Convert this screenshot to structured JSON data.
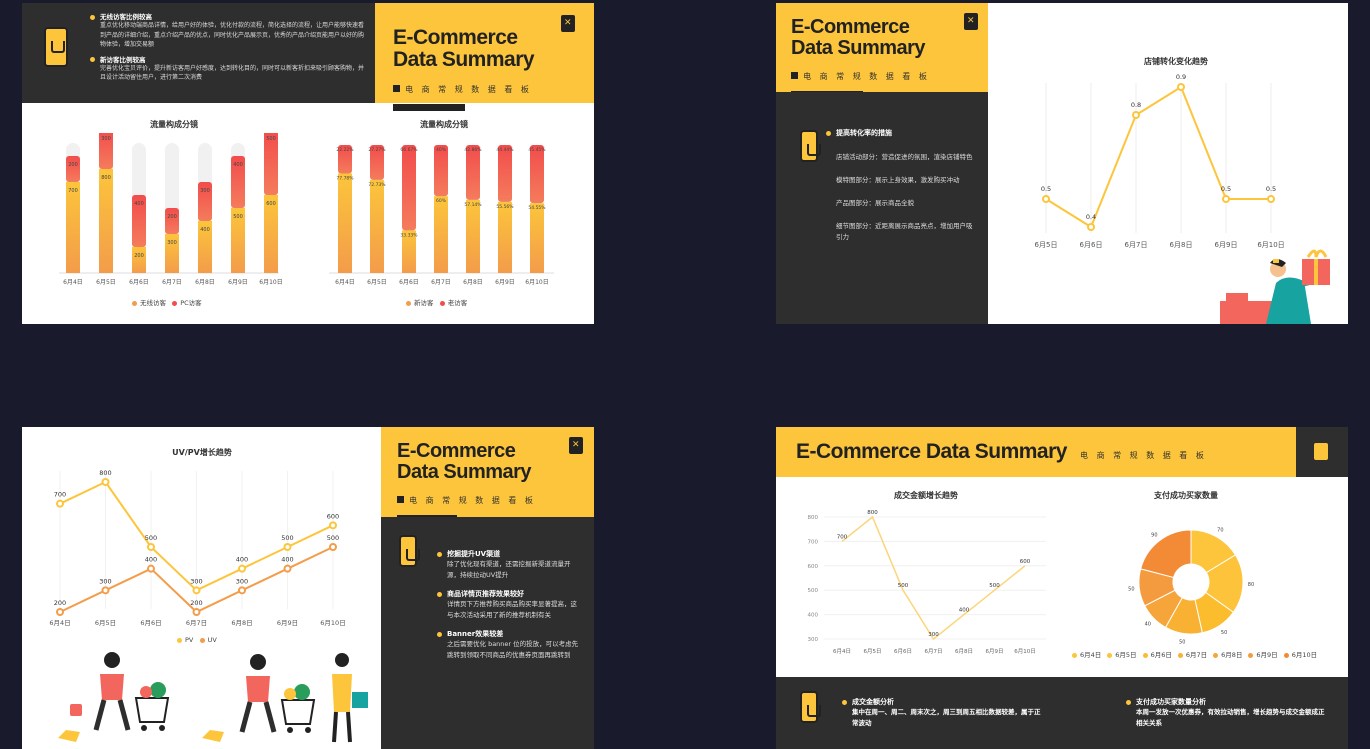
{
  "slide1": {
    "tip1_head": "无线访客比例较高",
    "tip1_body": "重点优化移动端商品详情，给用户好的体验，优化付款的流程，简化选择的流程，让用户能够快速看到产品的详细介绍，重点介绍产品的优点，同时优化产品展示页，优秀的产品介绍页能用户以好的购物体验，增加交易额",
    "tip2_head": "新访客比例较高",
    "tip2_body": "完善优化宝贝评价，提升新访客用户好感度，达到转化目的，同时可以新客折扣来吸引顾客购物，并且设计活动留住用户，进行第二次消费",
    "title_line1": "E-Commerce",
    "title_line2": "Data Summary",
    "subtitle": "电 商 常 规 数 据 看 板"
  },
  "slide2": {
    "title_line1": "E-Commerce",
    "title_line2": "Data Summary",
    "subtitle": "电 商 常 规 数 据 看 板",
    "tip_head": "提高转化率的措施",
    "tips": [
      "店铺活动部分：营造促进的氛围，渲染店铺特色",
      "模特图部分：展示上身效果，激发购买冲动",
      "产品图部分：展示商品全貌",
      "细节图部分：近距离展示商品亮点，增加用户吸引力"
    ]
  },
  "slide3": {
    "title_line1": "E-Commerce",
    "title_line2": "Data Summary",
    "subtitle": "电 商 常 规 数 据 看 板",
    "tips": [
      {
        "head": "挖掘提升UV渠道",
        "body": "除了优化现有渠道，还需挖掘新渠道流量开源，持续拉动UV提升"
      },
      {
        "head": "商品详情页推荐效果较好",
        "body": "详情页下方推荐购买商品购买率显著提高，这与本次活动采用了新的推荐机制有关"
      },
      {
        "head": "Banner效果较差",
        "body": "之后需要优化 banner 位的投放，可以考虑先跳转到领取不同商品的优惠券页面再跳转到"
      }
    ]
  },
  "slide4": {
    "title": "E-Commerce Data Summary",
    "subtitle": "电 商 常 规 数 据 看 板",
    "tip1_head": "成交金额分析",
    "tip1_body": "集中在周一、周二、周末次之，周三到周五相比数据较差，属于正常波动",
    "tip2_head": "支付成功买家数量分析",
    "tip2_body": "本周一发放一次优惠券，有效拉动销售，增长趋势与成交金额成正相关关系"
  },
  "colors": {
    "accent": "#fcc53b",
    "dark": "#2e2e2e",
    "orange": "#f39c4a",
    "red": "#f24c4c",
    "navy": "#191b2d"
  },
  "chart_data": [
    {
      "type": "bar",
      "title": "流量构成分镜",
      "categories": [
        "6月4日",
        "6月5日",
        "6月6日",
        "6月7日",
        "6月8日",
        "6月9日",
        "6月10日"
      ],
      "series": [
        {
          "name": "无线访客",
          "values": [
            700,
            800,
            200,
            300,
            400,
            500,
            600
          ]
        },
        {
          "name": "PC访客",
          "values": [
            200,
            300,
            400,
            200,
            300,
            400,
            500
          ]
        }
      ]
    },
    {
      "type": "bar",
      "title": "流量构成分镜",
      "categories": [
        "6月4日",
        "6月5日",
        "6月6日",
        "6月7日",
        "6月8日",
        "6月9日",
        "6月10日"
      ],
      "series": [
        {
          "name": "新访客",
          "values": [
            "77.78%",
            "72.73%",
            "33.33%",
            "60%",
            "57.14%",
            "55.56%",
            "54.55%"
          ]
        },
        {
          "name": "老访客",
          "values": [
            "22.22%",
            "27.27%",
            "66.67%",
            "40%",
            "42.86%",
            "44.44%",
            "45.45%"
          ]
        }
      ]
    },
    {
      "type": "line",
      "title": "店铺转化变化趋势",
      "categories": [
        "6月5日",
        "6月6日",
        "6月7日",
        "6月8日",
        "6月9日",
        "6月10日"
      ],
      "series": [
        {
          "values": [
            0.5,
            0.4,
            0.8,
            0.9,
            0.5,
            0.5
          ]
        }
      ]
    },
    {
      "type": "line",
      "title": "UV/PV增长趋势",
      "categories": [
        "6月4日",
        "6月5日",
        "6月6日",
        "6月7日",
        "6月8日",
        "6月9日",
        "6月10日"
      ],
      "series": [
        {
          "name": "PV",
          "values": [
            700,
            800,
            500,
            300,
            400,
            500,
            600
          ]
        },
        {
          "name": "UV",
          "values": [
            200,
            300,
            400,
            200,
            300,
            400,
            500
          ]
        }
      ]
    },
    {
      "type": "line",
      "title": "成交金额增长趋势",
      "categories": [
        "6月4日",
        "6月5日",
        "6月6日",
        "6月7日",
        "6月8日",
        "6月9日",
        "6月10日"
      ],
      "ylim": [
        300,
        800
      ],
      "yticks": [
        "300",
        "400",
        "500",
        "600",
        "700",
        "800"
      ],
      "series": [
        {
          "values": [
            700,
            800,
            500,
            300,
            400,
            500,
            600
          ]
        }
      ]
    },
    {
      "type": "pie",
      "title": "支付成功买家数量",
      "categories": [
        "6月4日",
        "6月5日",
        "6月6日",
        "6月7日",
        "6月8日",
        "6月9日",
        "6月10日"
      ],
      "values": [
        70,
        80,
        50,
        50,
        40,
        50,
        90
      ]
    }
  ]
}
